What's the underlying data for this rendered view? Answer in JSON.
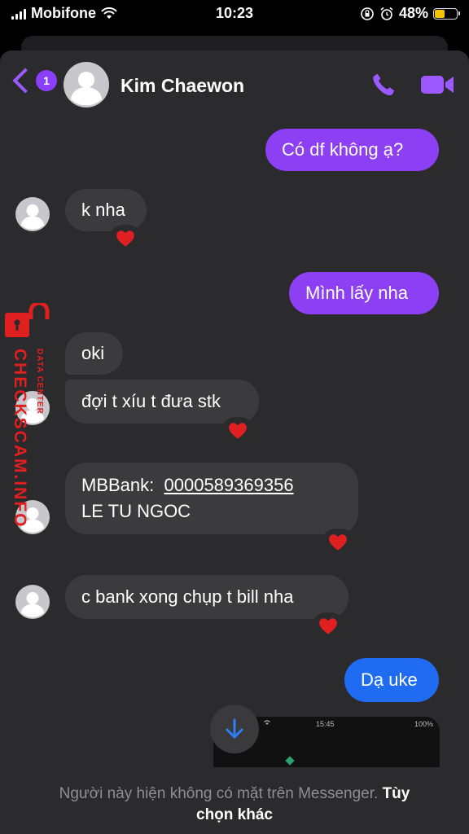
{
  "status_bar": {
    "carrier": "Mobifone",
    "time": "10:23",
    "battery": "48%",
    "battery_level": 0.48
  },
  "header": {
    "back_badge": "1",
    "contact_name": "Kim Chaewon"
  },
  "messages": [
    {
      "dir": "out",
      "text": "Có df không ạ?"
    },
    {
      "dir": "in",
      "text": "k nha",
      "reaction": "heart"
    },
    {
      "dir": "out",
      "text": "Mình lấy nha"
    },
    {
      "dir": "in",
      "text": "oki"
    },
    {
      "dir": "in",
      "text": "đợi t xíu t đưa stk",
      "reaction": "heart"
    },
    {
      "dir": "in",
      "line1_prefix": "MBBank:",
      "line1_account": "0000589369356",
      "line2": "LE TU NGOC",
      "reaction": "heart"
    },
    {
      "dir": "in",
      "text": "c bank xong chụp t bill nha",
      "reaction": "heart"
    },
    {
      "dir": "out",
      "text": "Dạ uke"
    }
  ],
  "image_preview": {
    "time": "15:45",
    "battery": "100%"
  },
  "footer": {
    "note": "Người này hiện không có mặt trên Messenger.",
    "option_part1": "Tùy",
    "option_part2": "chọn khác"
  },
  "watermark": {
    "main": "CHECKSCAM.INFO",
    "sub": "DATA CENTER"
  },
  "colors": {
    "outgoing": "#8c3ff3",
    "outgoing_blue": "#1f6cf2",
    "incoming": "#3b3b3e",
    "accent": "#9b59ff",
    "reaction": "#e02020"
  }
}
